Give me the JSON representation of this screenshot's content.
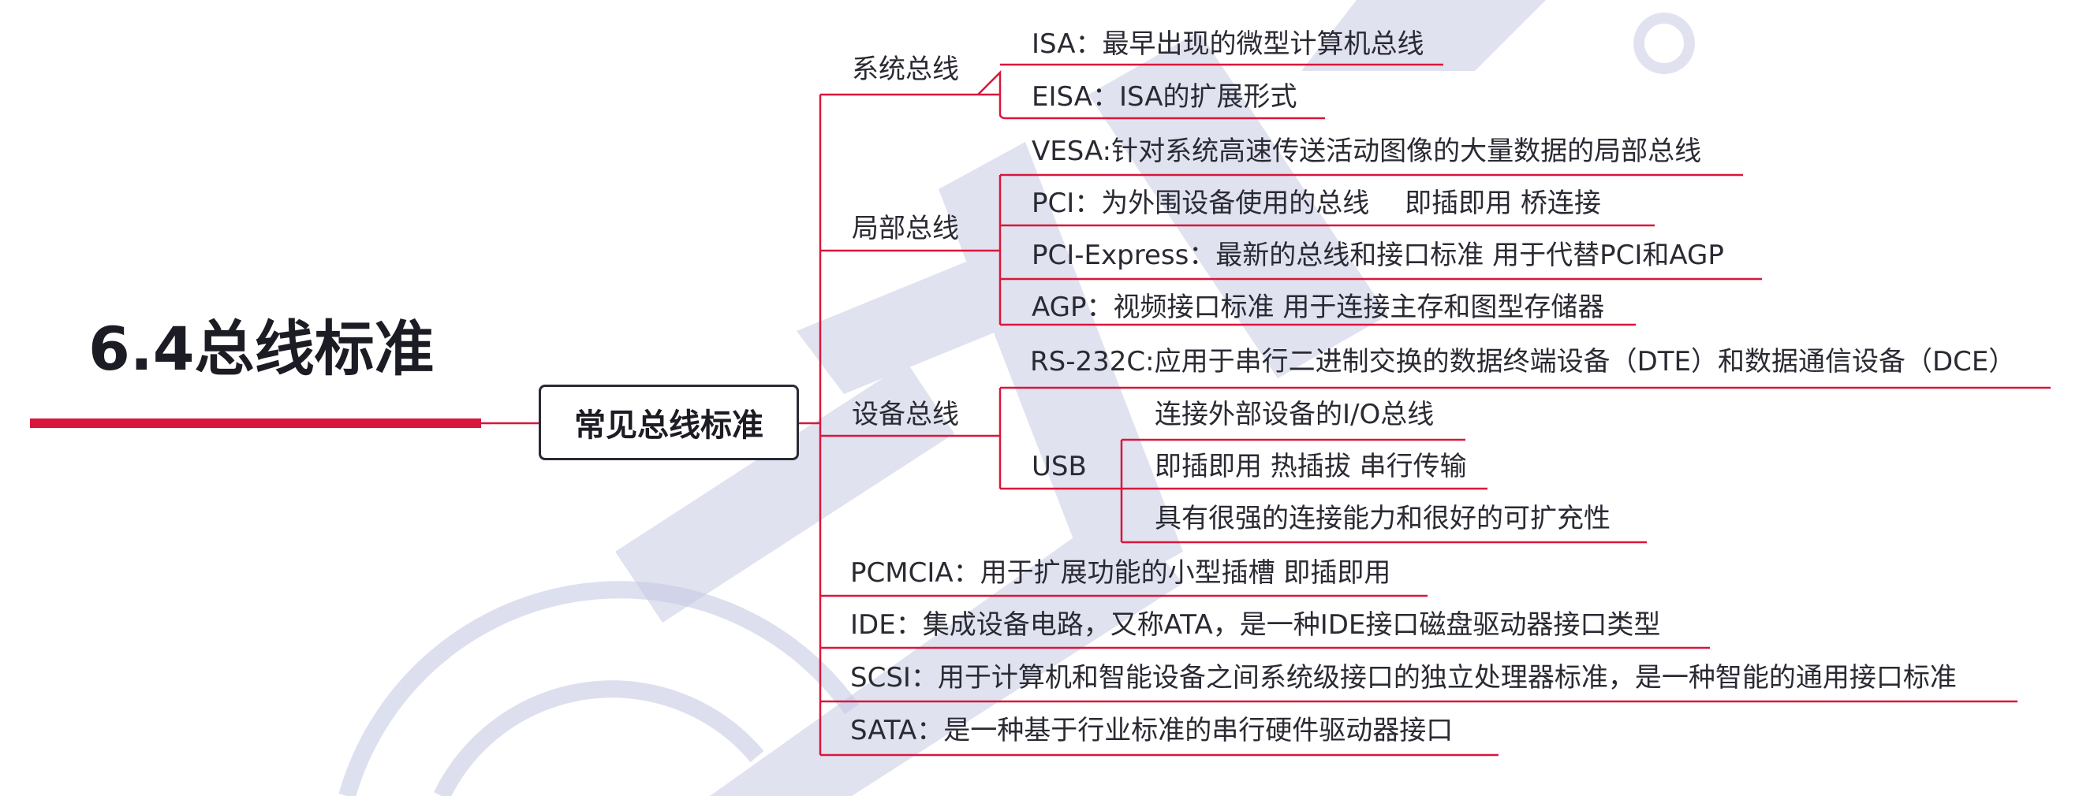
{
  "title": "6.4总线标准",
  "root": "常见总线标准",
  "colors": {
    "accent": "#d9163c",
    "text": "#2a2a33",
    "watermark": "#c7cbe3"
  },
  "watermark_icon": "forum-seal-watermark",
  "categories": {
    "system_bus": {
      "label": "系统总线",
      "items": [
        "ISA：最早出现的微型计算机总线",
        "EISA：ISA的扩展形式"
      ]
    },
    "local_bus": {
      "label": "局部总线",
      "items": [
        "VESA:针对系统高速传送活动图像的大量数据的局部总线",
        "PCI：为外围设备使用的总线　 即插即用   桥连接",
        "PCI-Express：最新的总线和接口标准 用于代替PCI和AGP",
        "AGP：视频接口标准 用于连接主存和图型存储器"
      ]
    },
    "device_bus": {
      "label": "设备总线",
      "rs232": "RS-232C:应用于串行二进制交换的数据终端设备（DTE）和数据通信设备（DCE）",
      "usb": {
        "label": "USB",
        "items": [
          "连接外部设备的I/O总线",
          "即插即用   热插拔  串行传输",
          "具有很强的连接能力和很好的可扩充性"
        ]
      }
    },
    "pcmcia": "PCMCIA：用于扩展功能的小型插槽 即插即用",
    "ide": "IDE：集成设备电路，又称ATA，是一种IDE接口磁盘驱动器接口类型",
    "scsi": "SCSI：用于计算机和智能设备之间系统级接口的独立处理器标准，是一种智能的通用接口标准",
    "sata": "SATA：是一种基于行业标准的串行硬件驱动器接口"
  }
}
